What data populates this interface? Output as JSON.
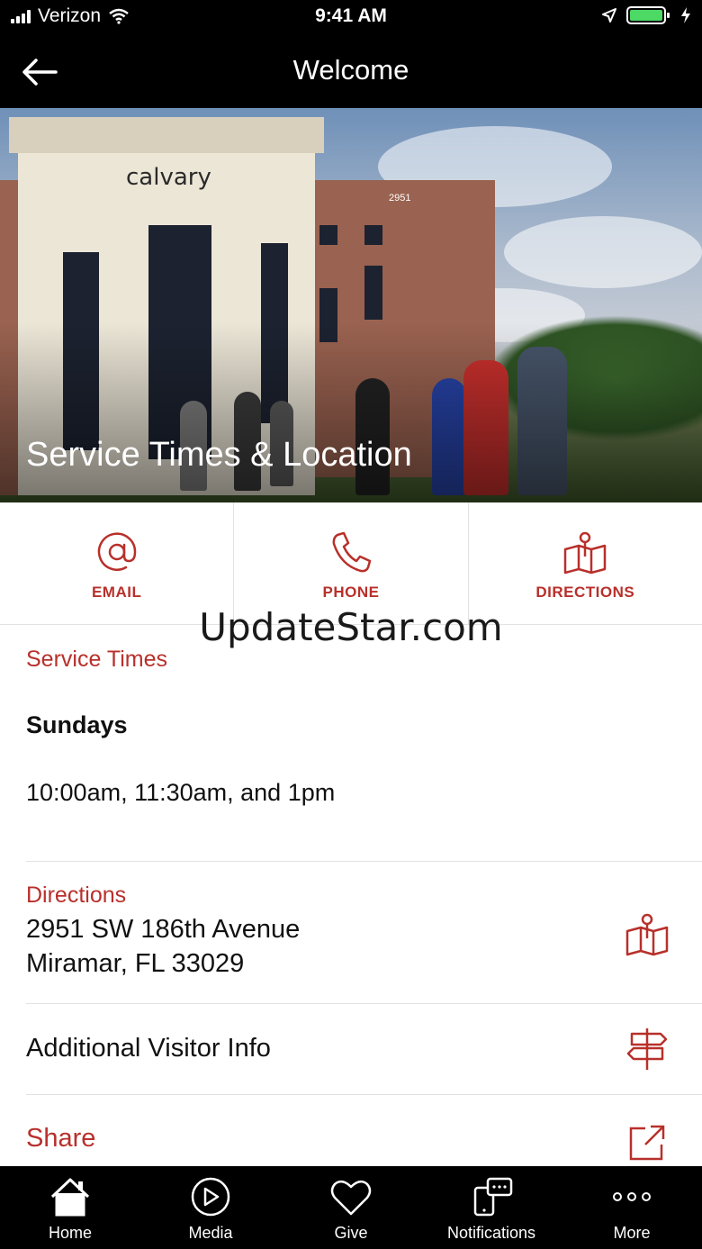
{
  "status_bar": {
    "carrier": "Verizon",
    "time": "9:41 AM"
  },
  "nav": {
    "title": "Welcome"
  },
  "hero": {
    "logo_text": "calvary",
    "building_number": "2951",
    "title": "Service Times & Location"
  },
  "actions": [
    {
      "label": "EMAIL",
      "icon": "at-sign-icon"
    },
    {
      "label": "PHONE",
      "icon": "phone-icon"
    },
    {
      "label": "DIRECTIONS",
      "icon": "map-pin-icon"
    }
  ],
  "watermark": "UpdateStar.com",
  "service": {
    "heading": "Service Times",
    "day": "Sundays",
    "times": "10:00am, 11:30am, and 1pm"
  },
  "directions": {
    "heading": "Directions",
    "line1": "2951 SW 186th Avenue",
    "line2": "Miramar, FL 33029"
  },
  "visitor": {
    "label": "Additional Visitor Info"
  },
  "share": {
    "label": "Share"
  },
  "tabs": [
    {
      "label": "Home",
      "icon": "home-icon"
    },
    {
      "label": "Media",
      "icon": "play-icon"
    },
    {
      "label": "Give",
      "icon": "heart-icon"
    },
    {
      "label": "Notifications",
      "icon": "chat-phone-icon"
    },
    {
      "label": "More",
      "icon": "more-icon"
    }
  ],
  "colors": {
    "accent": "#b8302b",
    "bar_background": "#000000",
    "divider": "#e2e2e2"
  }
}
